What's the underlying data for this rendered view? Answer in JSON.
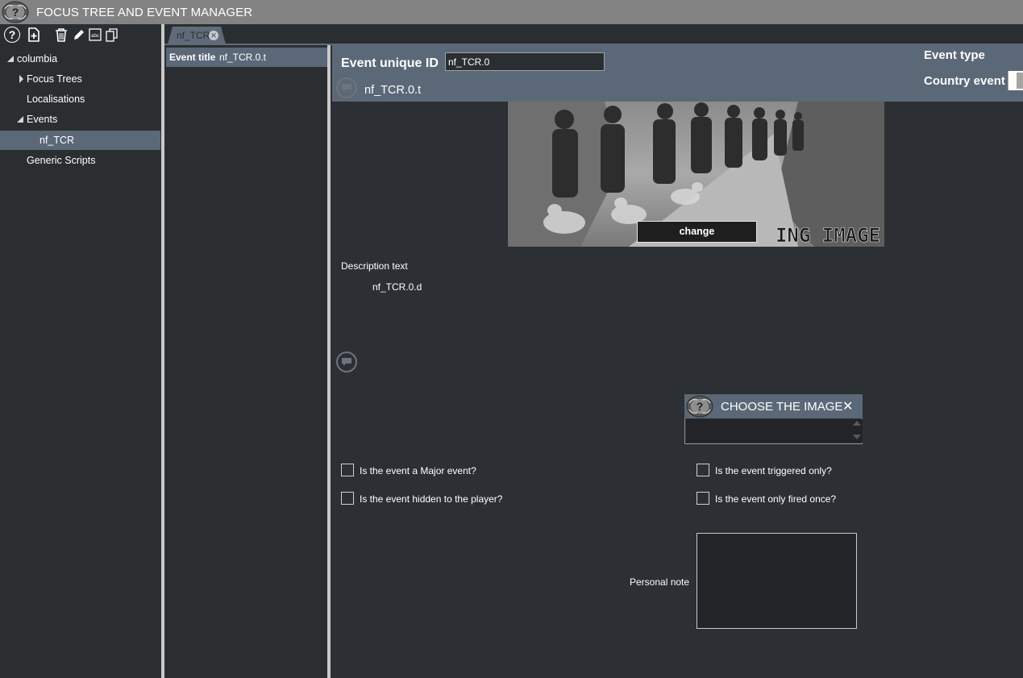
{
  "window": {
    "title": "FOCUS TREE AND EVENT MANAGER"
  },
  "toolbar": {
    "icons": [
      "help-icon",
      "new-file-icon",
      "delete-icon",
      "edit-icon",
      "spellcheck-icon",
      "copy-icon"
    ],
    "help_glyph": "?"
  },
  "tree": {
    "root": "columbia",
    "items": [
      {
        "label": "Focus Trees",
        "expanded": false
      },
      {
        "label": "Localisations"
      },
      {
        "label": "Events",
        "expanded": true
      },
      {
        "label": "nf_TCR",
        "selected": true
      },
      {
        "label": "Generic Scripts"
      }
    ]
  },
  "tabs": [
    {
      "label": "nf_TCR",
      "close_glyph": "✕"
    }
  ],
  "event_list": {
    "header_label": "Event title",
    "header_value": "nf_TCR.0.t"
  },
  "event": {
    "id_label": "Event unique ID",
    "id_value": "nf_TCR.0",
    "title_value": "nf_TCR.0.t",
    "type_label": "Event type",
    "type_value": "Country event",
    "image_overlay_text": "ING IMAGE",
    "change_button": "change",
    "description_label": "Description text",
    "description_value": "nf_TCR.0.d"
  },
  "dialog": {
    "title": "CHOOSE THE IMAGE",
    "close_glyph": "✕"
  },
  "checkboxes": [
    {
      "label": "Is the event a Major event?",
      "checked": false
    },
    {
      "label": "Is the event hidden to the player?",
      "checked": false
    },
    {
      "label": "Is the event triggered only?",
      "checked": false
    },
    {
      "label": "Is the event only fired once?",
      "checked": false
    }
  ],
  "note": {
    "label": "Personal note",
    "value": ""
  },
  "colors": {
    "accent": "#5b6877",
    "background": "#2c2f33",
    "titlebar": "#838383"
  }
}
